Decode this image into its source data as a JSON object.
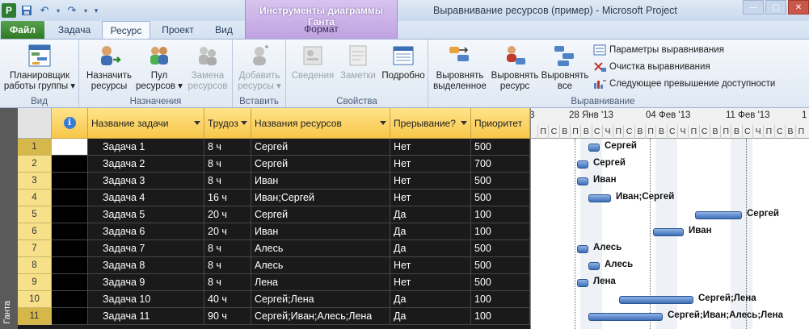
{
  "window": {
    "title": "Выравнивание ресурсов (пример)  -  Microsoft Project",
    "contextual_group": "Инструменты диаграммы Ганта",
    "contextual_tab": "Формат"
  },
  "tabs": [
    "Файл",
    "Задача",
    "Ресурс",
    "Проект",
    "Вид"
  ],
  "ribbon": {
    "groups": {
      "view": "Вид",
      "assignments": "Назначения",
      "insert": "Вставить",
      "properties": "Свойства",
      "leveling": "Выравнивание"
    },
    "team_planner": [
      "Планировщик",
      "работы группы"
    ],
    "assign": [
      "Назначить",
      "ресурсы"
    ],
    "pool": [
      "Пул",
      "ресурсов"
    ],
    "replace": [
      "Замена",
      "ресурсов"
    ],
    "add": [
      "Добавить",
      "ресурсы"
    ],
    "info": "Сведения",
    "notes": "Заметки",
    "details": "Подробно",
    "level_sel": [
      "Выровнять",
      "выделенное"
    ],
    "level_res": [
      "Выровнять",
      "ресурс"
    ],
    "level_all": [
      "Выровнять",
      "все"
    ],
    "lev_options": "Параметры выравнивания",
    "lev_clear": "Очистка выравнивания",
    "lev_next": "Следующее превышение доступности"
  },
  "sidebar_label": "Ганта",
  "columns": [
    "Название задачи",
    "Трудоз",
    "Названия ресурсов",
    "Прерывание?",
    "Приоритет"
  ],
  "rows": [
    {
      "n": "1",
      "task": "Задача 1",
      "work": "8 ч",
      "res": "Сергей",
      "brk": "Нет",
      "pr": "500"
    },
    {
      "n": "2",
      "task": "Задача 2",
      "work": "8 ч",
      "res": "Сергей",
      "brk": "Нет",
      "pr": "700"
    },
    {
      "n": "3",
      "task": "Задача 3",
      "work": "8 ч",
      "res": "Иван",
      "brk": "Нет",
      "pr": "500"
    },
    {
      "n": "4",
      "task": "Задача 4",
      "work": "16 ч",
      "res": "Иван;Сергей",
      "brk": "Нет",
      "pr": "500"
    },
    {
      "n": "5",
      "task": "Задача 5",
      "work": "20 ч",
      "res": "Сергей",
      "brk": "Да",
      "pr": "100"
    },
    {
      "n": "6",
      "task": "Задача 6",
      "work": "20 ч",
      "res": "Иван",
      "brk": "Да",
      "pr": "100"
    },
    {
      "n": "7",
      "task": "Задача 7",
      "work": "8 ч",
      "res": "Алесь",
      "brk": "Да",
      "pr": "500"
    },
    {
      "n": "8",
      "task": "Задача 8",
      "work": "8 ч",
      "res": "Алесь",
      "brk": "Нет",
      "pr": "500"
    },
    {
      "n": "9",
      "task": "Задача 9",
      "work": "8 ч",
      "res": "Лена",
      "brk": "Нет",
      "pr": "500"
    },
    {
      "n": "10",
      "task": "Задача 10",
      "work": "40 ч",
      "res": "Сергей;Лена",
      "brk": "Да",
      "pr": "100"
    },
    {
      "n": "11",
      "task": "Задача 11",
      "work": "90 ч",
      "res": "Сергей;Иван;Алесь;Лена",
      "brk": "Да",
      "pr": "100"
    }
  ],
  "gantt": {
    "weeks": [
      "3",
      "28 Янв '13",
      "04 Фев '13",
      "11 Фев '13",
      "1"
    ],
    "day_letters": [
      "П",
      "С",
      "В",
      "П",
      "В",
      "С",
      "Ч",
      "П",
      "С",
      "В",
      "П",
      "В",
      "С",
      "Ч",
      "П",
      "С",
      "В",
      "П",
      "В",
      "С",
      "Ч",
      "П",
      "С",
      "В",
      "П"
    ],
    "bar_labels": [
      "Сергей",
      "Сергей",
      "Иван",
      "Иван;Сергей",
      "Сергей",
      "Иван",
      "Алесь",
      "Алесь",
      "Лена",
      "Сергей;Лена",
      "Сергей;Иван;Алесь;Лена"
    ]
  }
}
